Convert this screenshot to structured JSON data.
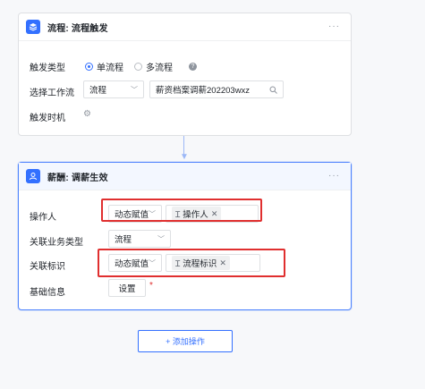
{
  "trigger_card": {
    "title": "流程: 流程触发",
    "more": "···",
    "trigger_type_label": "触发类型",
    "options": [
      "单流程",
      "多流程"
    ],
    "selected_option": "单流程",
    "workflow_label": "选择工作流",
    "workflow_select_value": "流程",
    "workflow_search_value": "薪资档案调薪202203wxz",
    "trigger_time_label": "触发时机"
  },
  "action_card": {
    "title": "薪酬: 调薪生效",
    "more": "···",
    "operator_label": "操作人",
    "operator_mode": "动态赋值",
    "operator_tag": "操作人",
    "biz_type_label": "关联业务类型",
    "biz_type_value": "流程",
    "identifier_label": "关联标识",
    "identifier_mode": "动态赋值",
    "identifier_tag": "流程标识",
    "base_info_label": "基础信息",
    "base_info_button": "设置",
    "required_mark": "*"
  },
  "add_action_label": "+ 添加操作",
  "colors": {
    "primary": "#3370ff",
    "highlight": "#e02f2f",
    "border": "#dee0e3"
  }
}
